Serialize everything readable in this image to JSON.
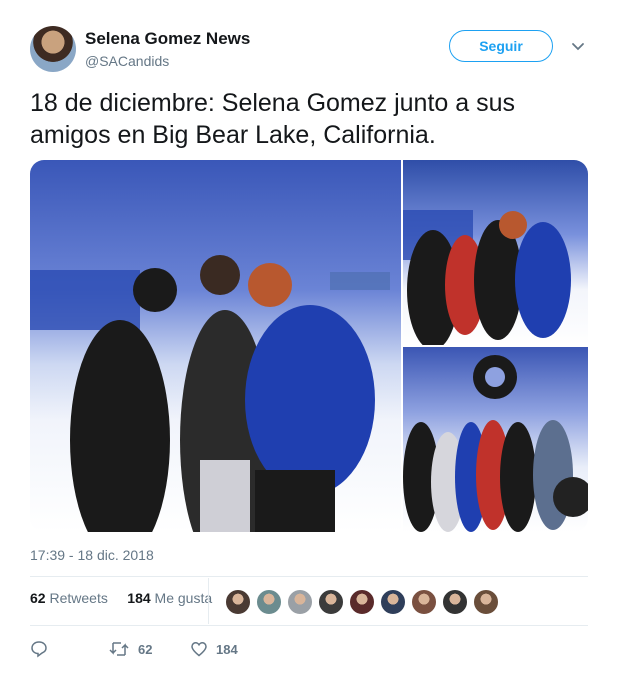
{
  "account": {
    "display_name": "Selena Gomez News",
    "handle": "@SACandids"
  },
  "follow_button": {
    "label": "Seguir"
  },
  "tweet": {
    "text": "18 de diciembre: Selena Gomez junto a sus amigos en Big Bear Lake, California.",
    "timestamp": "17:39 - 18 dic. 2018"
  },
  "stats": {
    "retweets_count": "62",
    "retweets_label": "Retweets",
    "likes_count": "184",
    "likes_label": "Me gusta"
  },
  "likers": [
    {
      "color": "#4a3a33"
    },
    {
      "color": "#6b8c8f"
    },
    {
      "color": "#9aa0a6"
    },
    {
      "color": "#3b3b3b"
    },
    {
      "color": "#5a2a2a"
    },
    {
      "color": "#2f3e5a"
    },
    {
      "color": "#7a5040"
    },
    {
      "color": "#333333"
    },
    {
      "color": "#6a4e3a"
    }
  ],
  "actions": {
    "reply_icon": "reply-icon",
    "retweet_count": "62",
    "like_count": "184"
  },
  "colors": {
    "accent": "#1da1f2",
    "secondary_text": "#657786",
    "primary_text": "#14171a",
    "divider": "#e6ecf0"
  }
}
